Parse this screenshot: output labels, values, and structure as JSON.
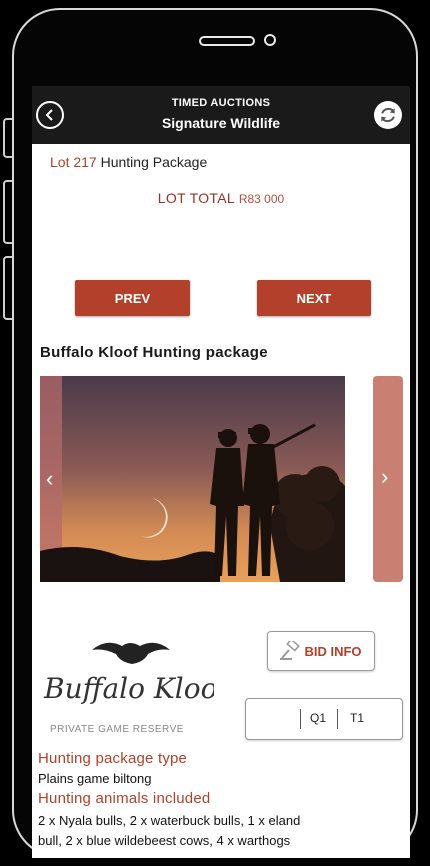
{
  "header": {
    "title": "TIMED AUCTIONS",
    "subtitle": "Signature Wildlife"
  },
  "lot": {
    "number": "Lot 217",
    "name": "Hunting Package",
    "total_label": "LOT TOTAL",
    "total_value": "R83 000"
  },
  "nav": {
    "prev_label": "PREV",
    "next_label": "NEXT"
  },
  "package": {
    "title": "Buffalo Kloof Hunting package"
  },
  "logo": {
    "name": "Buffalo Kloof",
    "tagline": "PRIVATE GAME RESERVE"
  },
  "bid": {
    "label": "BID INFO",
    "q_label": "Q1",
    "t_label": "T1"
  },
  "details": {
    "type_heading": "Hunting package type",
    "type_text": "Plains game biltong",
    "animals_heading": "Hunting animals included",
    "animals_line1": "2 x Nyala bulls, 2 x waterbuck bulls, 1 x eland",
    "animals_line2": "bull, 2 x blue wildebeest cows, 4 x warthogs"
  },
  "icons": {
    "back": "back-arrow-icon",
    "refresh": "refresh-icon",
    "gavel": "gavel-icon",
    "gallery_prev": "chevron-left-icon",
    "gallery_next": "chevron-right-icon"
  },
  "colors": {
    "accent": "#b3402a",
    "header_bg": "#1a1a1a"
  }
}
